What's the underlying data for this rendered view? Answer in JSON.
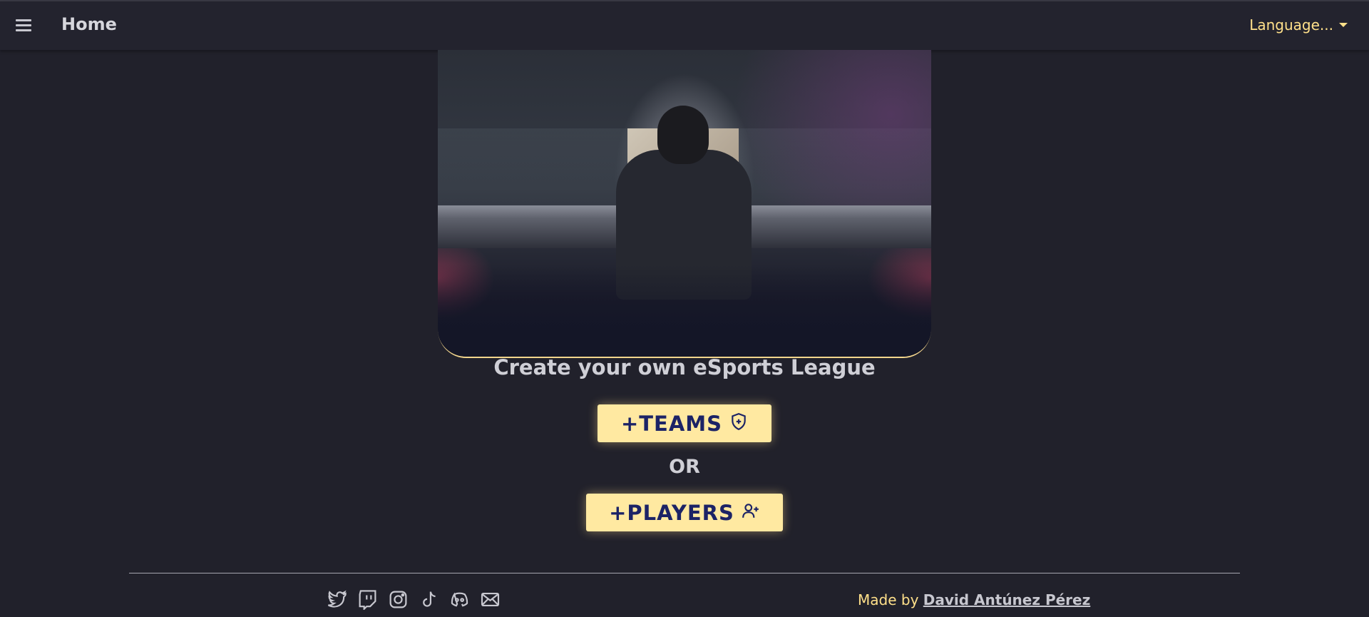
{
  "header": {
    "title": "Home",
    "language_label": "Language..."
  },
  "main": {
    "tagline": "Create your own eSports League",
    "teams_button": "+TEAMS",
    "or_label": "OR",
    "players_button": "+PLAYERS"
  },
  "footer": {
    "social_icons": [
      "twitter-icon",
      "twitch-icon",
      "instagram-icon",
      "tiktok-icon",
      "discord-icon",
      "mail-icon"
    ],
    "made_by_label": "Made by ",
    "author_name": "David Antúnez Pérez"
  },
  "colors": {
    "background": "#21212b",
    "accent": "#ffe08a",
    "button_bg": "#ffe9a1",
    "button_text": "#1c2366"
  }
}
